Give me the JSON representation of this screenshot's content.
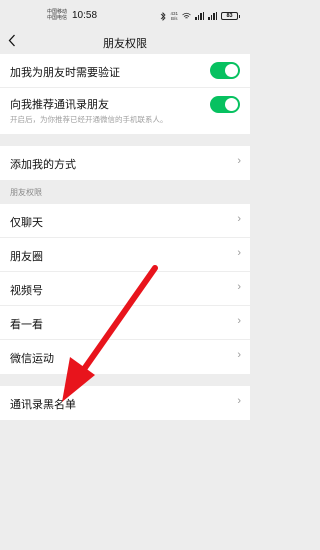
{
  "status": {
    "carrier1": "中国移动",
    "carrier2": "中国电信",
    "time": "10:58",
    "net_speed": "431",
    "net_unit": "B/s",
    "battery": "83"
  },
  "nav": {
    "title": "朋友权限",
    "back_icon": "chevron-left-icon"
  },
  "verify": {
    "label": "加我为朋友时需要验证",
    "enabled": true
  },
  "recommend": {
    "label": "向我推荐通讯录朋友",
    "desc": "开启后，为你推荐已经开通微信的手机联系人。",
    "enabled": true
  },
  "add_me": {
    "label": "添加我的方式"
  },
  "section": {
    "header": "朋友权限"
  },
  "permissions": [
    "仅聊天",
    "朋友圈",
    "视频号",
    "看一看",
    "微信运动"
  ],
  "blacklist": {
    "label": "通讯录黑名单"
  },
  "colors": {
    "accent": "#07c160",
    "annotation_arrow": "#e8141c"
  }
}
